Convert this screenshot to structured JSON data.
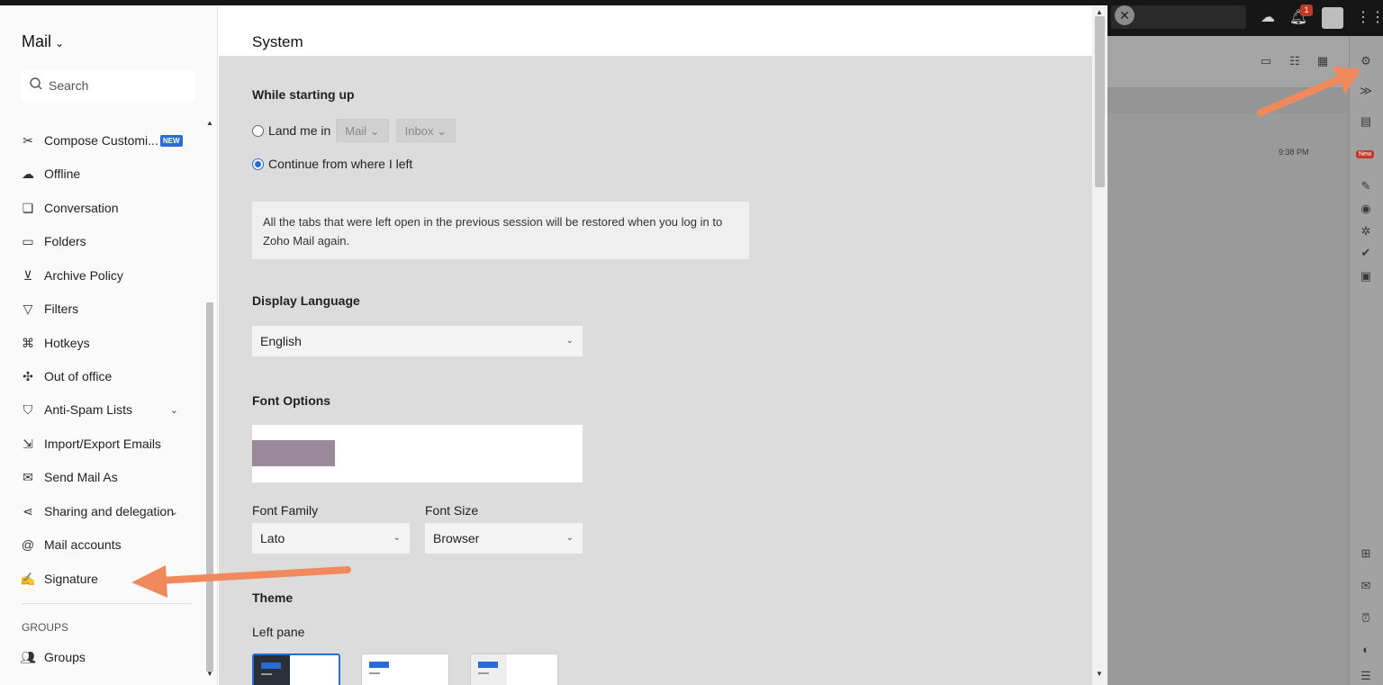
{
  "left_pane": {
    "app_title": "Mail",
    "search_placeholder": "Search",
    "items": [
      {
        "label": "Compose Customi...",
        "icon": "customize-icon",
        "badge": "NEW"
      },
      {
        "label": "Offline",
        "icon": "offline-icon"
      },
      {
        "label": "Conversation",
        "icon": "conversation-icon"
      },
      {
        "label": "Folders",
        "icon": "folder-icon"
      },
      {
        "label": "Archive Policy",
        "icon": "archive-icon"
      },
      {
        "label": "Filters",
        "icon": "filter-icon"
      },
      {
        "label": "Hotkeys",
        "icon": "command-key-icon"
      },
      {
        "label": "Out of office",
        "icon": "out-of-office-icon"
      },
      {
        "label": "Anti-Spam Lists",
        "icon": "shield-icon"
      },
      {
        "label": "Import/Export Emails",
        "icon": "import-export-icon"
      },
      {
        "label": "Send Mail As",
        "icon": "send-as-icon"
      },
      {
        "label": "Sharing and delegation",
        "icon": "share-icon"
      },
      {
        "label": "Mail accounts",
        "icon": "at-sign-icon"
      },
      {
        "label": "Signature",
        "icon": "signature-icon"
      }
    ],
    "groups_header": "GROUPS",
    "groups_item": "Groups"
  },
  "content": {
    "page_title": "System",
    "startup": {
      "title": "While starting up",
      "land_me_in": "Land me in",
      "land_app": "Mail",
      "land_folder": "Inbox",
      "continue_label": "Continue from where I left",
      "info_text": "All the tabs that were left open in the previous session will be restored when you log in to Zoho Mail again."
    },
    "display_language": {
      "title": "Display Language",
      "value": "English"
    },
    "font_options": {
      "title": "Font Options",
      "family_label": "Font Family",
      "family_value": "Lato",
      "size_label": "Font Size",
      "size_value": "Browser"
    },
    "theme": {
      "title": "Theme",
      "left_pane_label": "Left pane"
    }
  },
  "background": {
    "time": "9:38 PM",
    "notification_count": "1",
    "new_label": "New"
  },
  "colors": {
    "accent": "#2a6bd8",
    "annotation_arrow": "#f08a5d"
  }
}
